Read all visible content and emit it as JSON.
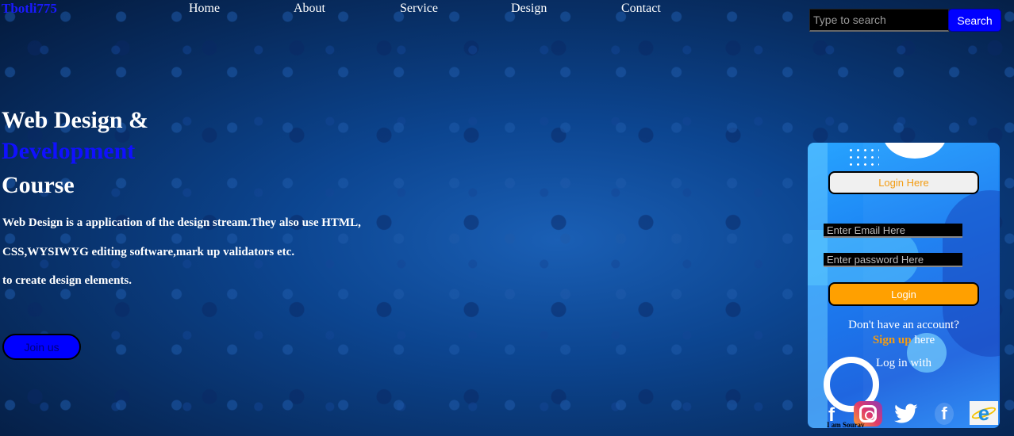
{
  "header": {
    "logo": "Tbotli775",
    "nav": [
      "Home",
      "About",
      "Service",
      "Design",
      "Contact"
    ],
    "search": {
      "placeholder": "Type to search",
      "button": "Search"
    }
  },
  "hero": {
    "line1": "Web Design &",
    "line2": "Development",
    "line3": "Course",
    "desc1": "Web Design is a application of the design stream.They also use HTML,",
    "desc2": "CSS,WYSIWYG editing software,mark up validators etc.",
    "desc3": "to create design elements.",
    "join": "Join us"
  },
  "login": {
    "title": "Login Here",
    "email_placeholder": "Enter Email Here",
    "password_placeholder": "Enter password Here",
    "button": "Login",
    "no_account": "Don't have an account?",
    "signup_link": "Sign up",
    "signup_suffix": " here",
    "log_in_with": "Log in with",
    "footer": "I am Sourav"
  },
  "icons": {
    "socials": [
      "facebook-icon",
      "instagram-icon",
      "twitter-icon",
      "facebook-icon",
      "internet-explorer-icon"
    ]
  },
  "colors": {
    "accent": "#0000ff",
    "login_accent": "#ffa000",
    "signup": "#f39c12"
  }
}
